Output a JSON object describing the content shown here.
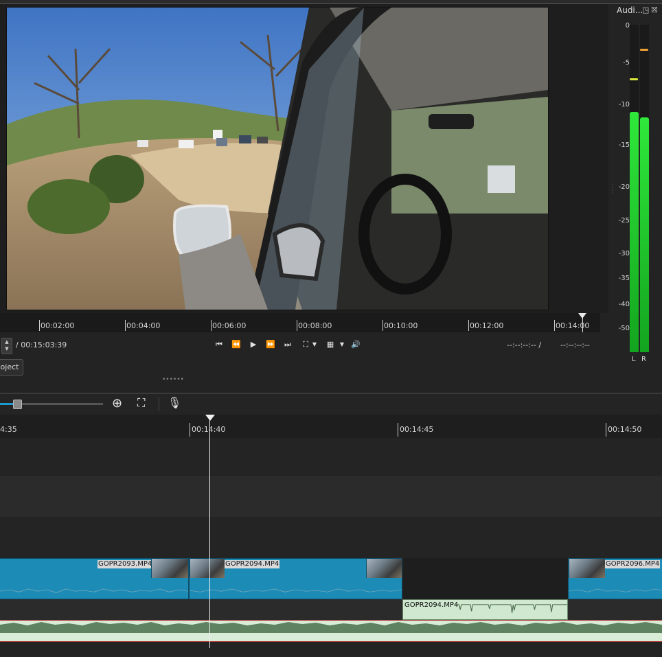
{
  "meter": {
    "title": "Audi...",
    "scale": [
      "0",
      "-5",
      "-10",
      "-15",
      "-20",
      "-25",
      "-30",
      "-35",
      "-40",
      "-50"
    ],
    "left_label": "L",
    "right_label": "R",
    "left_level_db": -16.5,
    "right_level_db": -17.5,
    "colors": {
      "bar": "#20c52c",
      "peak_high": "#f0a030",
      "peak_mid": "#d8e83a"
    }
  },
  "scrub": {
    "labels": [
      "00:02:00",
      "00:04:00",
      "00:06:00",
      "00:08:00",
      "00:10:00",
      "00:12:00",
      "00:14:00"
    ]
  },
  "transport": {
    "duration": "/ 00:15:03:39",
    "in_point": "--:--:--:-- /",
    "out_point": "--:--:--:--"
  },
  "project_button": "oject",
  "timeline": {
    "ruler": [
      "4:35",
      "00:14:40",
      "00:14:45",
      "00:14:50"
    ],
    "video_clips": [
      {
        "name": "GOPR2093.MP4"
      },
      {
        "name": "GOPR2094.MP4"
      },
      {
        "name": "GOPR2096.MP4"
      }
    ],
    "audio_clip": {
      "name": "GOPR2094.MP4"
    },
    "colors": {
      "video_clip": "#1c8cb7",
      "audio_clip": "#cfe8cf",
      "master_audio": "#d8ecd8"
    }
  }
}
